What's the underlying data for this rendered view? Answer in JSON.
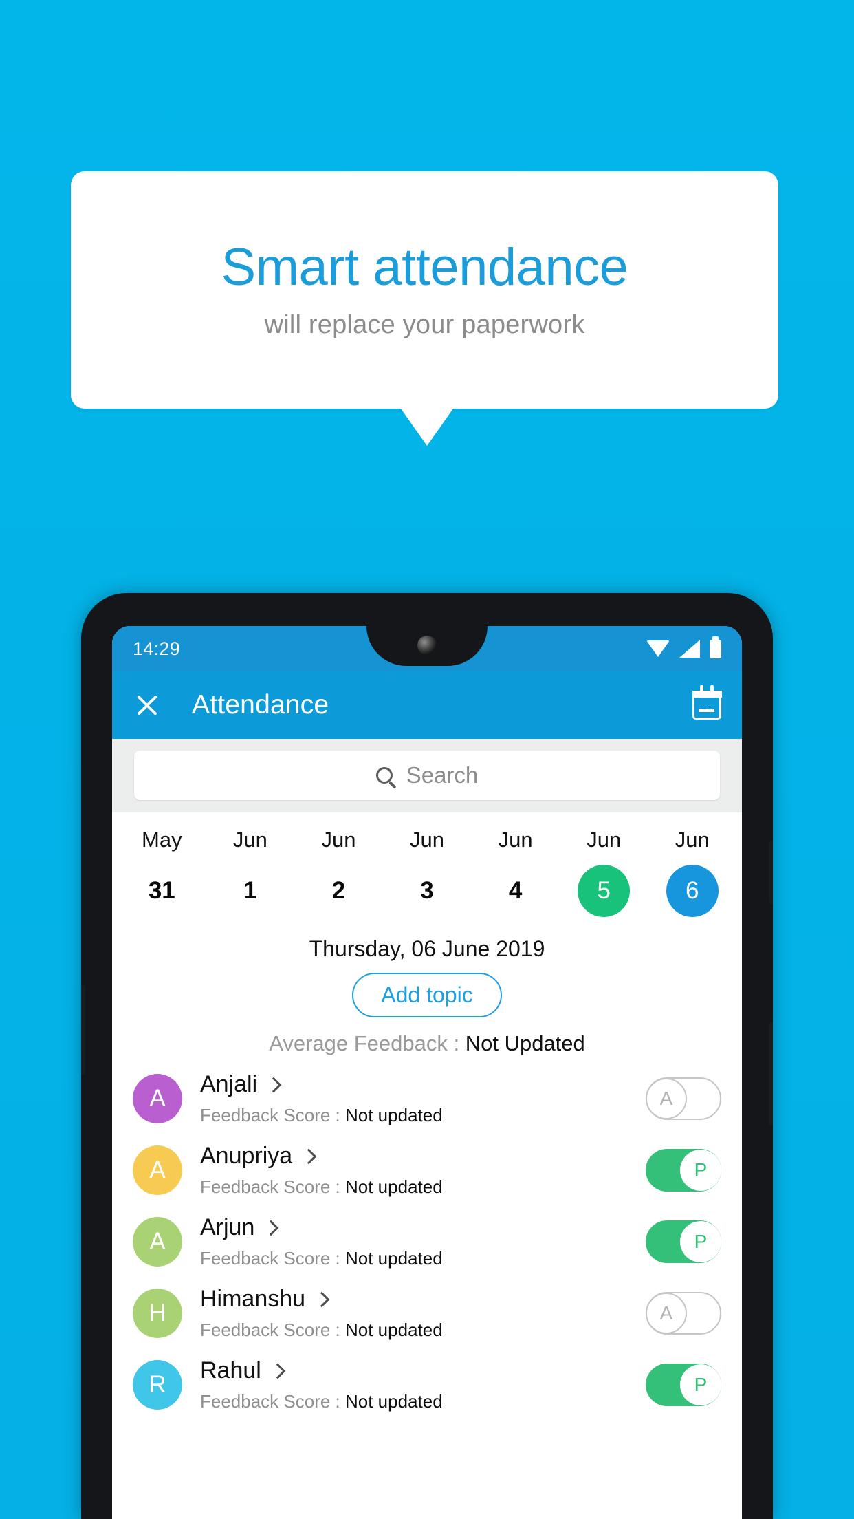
{
  "promo": {
    "title": "Smart attendance",
    "subtitle": "will replace your paperwork",
    "background_color": "#03b3e8",
    "title_color": "#1b9ddb"
  },
  "phone": {
    "statusbar": {
      "time": "14:29",
      "icons": [
        "wifi-icon",
        "signal-icon",
        "battery-icon"
      ]
    },
    "appbar": {
      "close_icon": "close-icon",
      "title": "Attendance",
      "calendar_icon": "calendar-icon",
      "background_color": "#0c9ad9"
    },
    "search": {
      "placeholder": "Search",
      "icon": "search-icon"
    },
    "dates": [
      {
        "month": "May",
        "day": "31",
        "state": "normal"
      },
      {
        "month": "Jun",
        "day": "1",
        "state": "normal"
      },
      {
        "month": "Jun",
        "day": "2",
        "state": "normal"
      },
      {
        "month": "Jun",
        "day": "3",
        "state": "normal"
      },
      {
        "month": "Jun",
        "day": "4",
        "state": "normal"
      },
      {
        "month": "Jun",
        "day": "5",
        "state": "today"
      },
      {
        "month": "Jun",
        "day": "6",
        "state": "selected"
      }
    ],
    "date_colors": {
      "today": "#18c27a",
      "selected": "#1796de"
    },
    "selected_date_label": "Thursday, 06 June 2019",
    "add_topic_label": "Add topic",
    "average_feedback": {
      "label": "Average Feedback : ",
      "value": "Not Updated"
    },
    "feedback_label": "Feedback Score : ",
    "students": [
      {
        "name": "Anjali",
        "initial": "A",
        "avatar_color": "#b95fd0",
        "feedback": "Not updated",
        "attendance": "A",
        "present": false
      },
      {
        "name": "Anupriya",
        "initial": "A",
        "avatar_color": "#f7ca52",
        "feedback": "Not updated",
        "attendance": "P",
        "present": true
      },
      {
        "name": "Arjun",
        "initial": "A",
        "avatar_color": "#a8d274",
        "feedback": "Not updated",
        "attendance": "P",
        "present": true
      },
      {
        "name": "Himanshu",
        "initial": "H",
        "avatar_color": "#a8d274",
        "feedback": "Not updated",
        "attendance": "A",
        "present": false
      },
      {
        "name": "Rahul",
        "initial": "R",
        "avatar_color": "#3fc6e8",
        "feedback": "Not updated",
        "attendance": "P",
        "present": true
      }
    ]
  }
}
